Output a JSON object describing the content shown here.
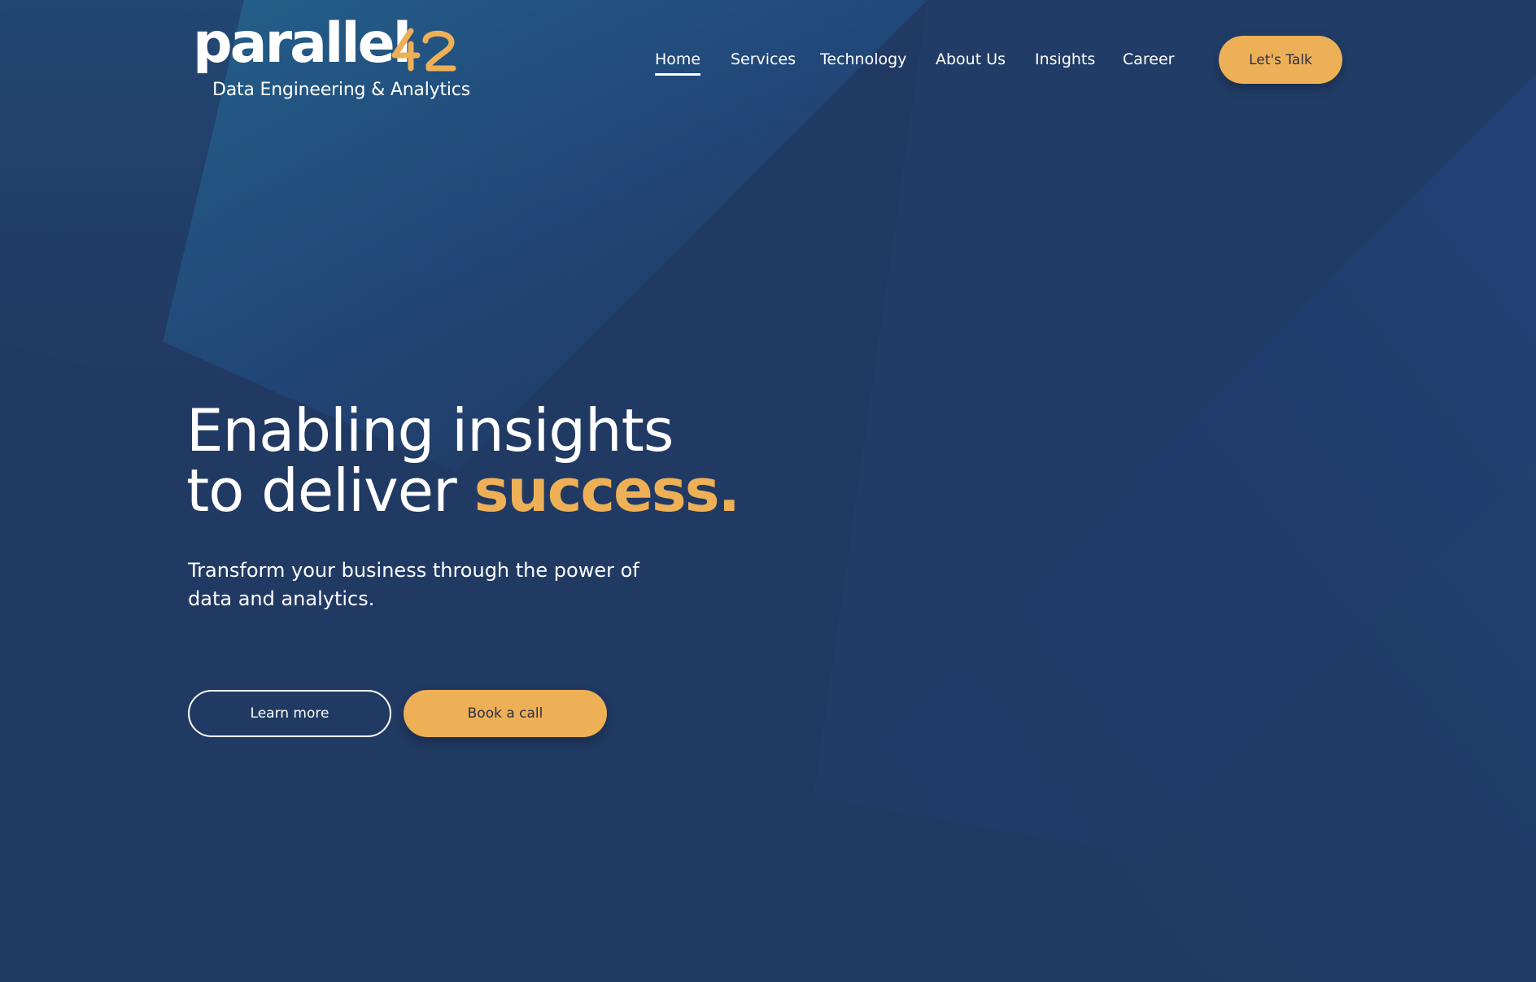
{
  "brand": {
    "name": "parallel",
    "mark": "42",
    "tagline": "Data Engineering & Analytics"
  },
  "nav": {
    "items": [
      {
        "label": "Home",
        "active": true
      },
      {
        "label": "Services",
        "active": false
      },
      {
        "label": "Technology",
        "active": false
      },
      {
        "label": "About Us",
        "active": false
      },
      {
        "label": "Insights",
        "active": false
      },
      {
        "label": "Career",
        "active": false
      }
    ],
    "cta_label": "Let's Talk"
  },
  "hero": {
    "title_line1": "Enabling insights",
    "title_line2_prefix": "to deliver ",
    "title_line2_accent": "success.",
    "subtitle": "Transform your business through the power of data and analytics.",
    "primary_button": "Learn more",
    "secondary_button": "Book a call"
  },
  "colors": {
    "background": "#213a63",
    "accent": "#eeb057",
    "button_text": "#2a2f45",
    "text": "#ffffff"
  }
}
